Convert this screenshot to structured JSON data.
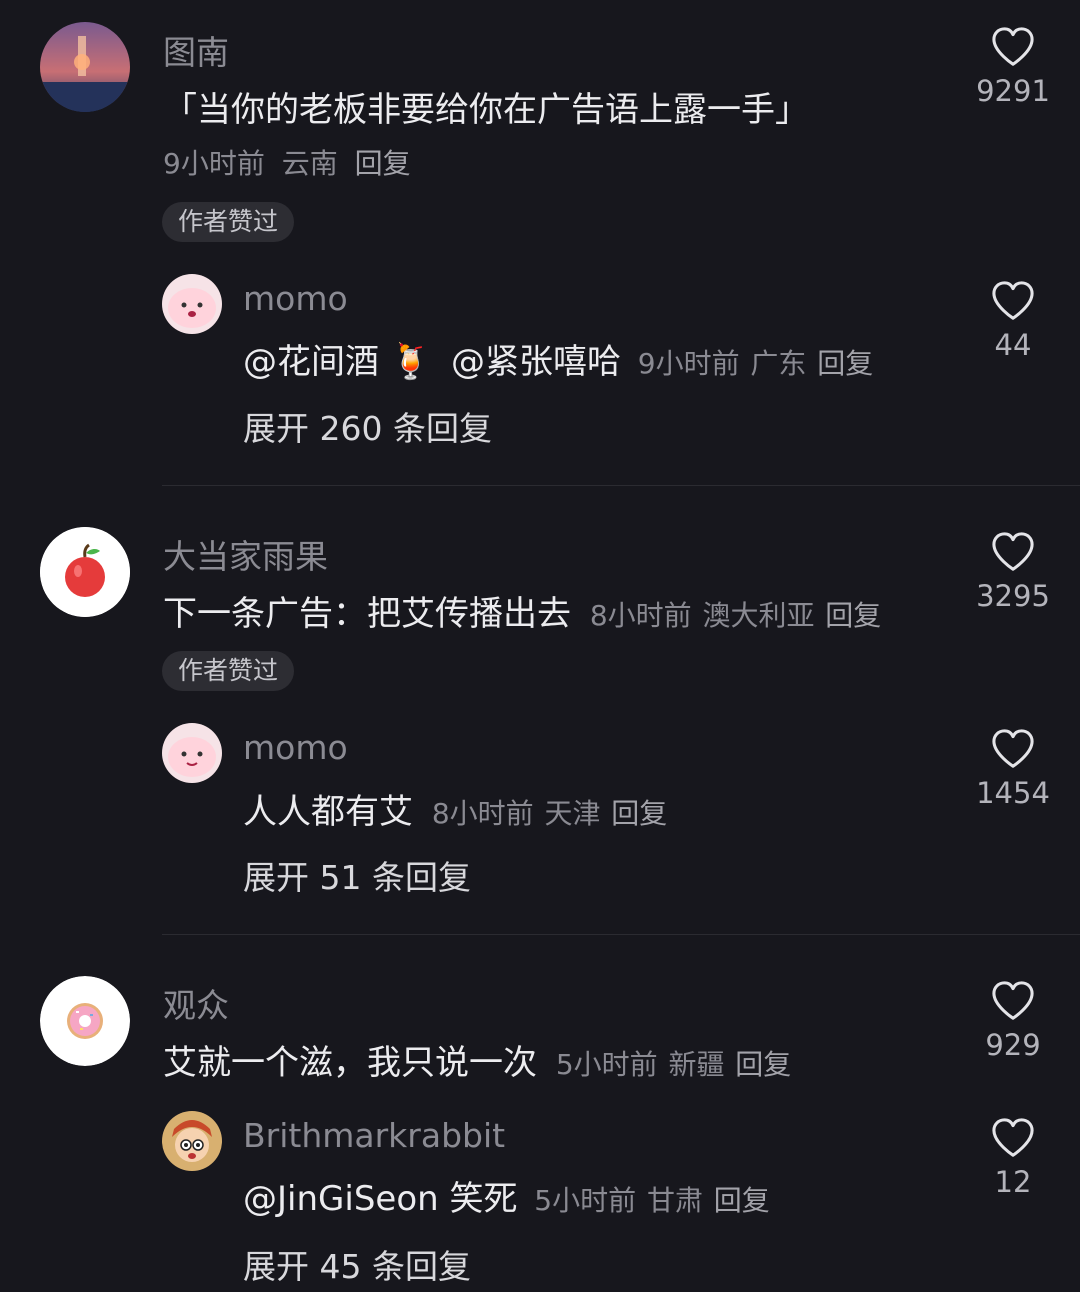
{
  "comments": [
    {
      "username": "图南",
      "text": "「当你的老板非要给你在广告语上露一手」",
      "time": "9小时前",
      "location": "云南",
      "reply_label": "回复",
      "likes": "9291",
      "badge": "作者赞过",
      "sub_reply": {
        "username": "momo",
        "mentions": [
          "@花间酒",
          "🍹",
          "@紧张嘻哈"
        ],
        "time": "9小时前",
        "location": "广东",
        "reply_label": "回复",
        "likes": "44"
      },
      "expand_label": "展开 260 条回复"
    },
    {
      "username": "大当家雨果",
      "text": "下一条广告：把艾传播出去",
      "time": "8小时前",
      "location": "澳大利亚",
      "reply_label": "回复",
      "likes": "3295",
      "badge": "作者赞过",
      "sub_reply": {
        "username": "momo",
        "text": "人人都有艾",
        "time": "8小时前",
        "location": "天津",
        "reply_label": "回复",
        "likes": "1454"
      },
      "expand_label": "展开 51 条回复"
    },
    {
      "username": "观众",
      "text": "艾就一个滋，我只说一次",
      "time": "5小时前",
      "location": "新疆",
      "reply_label": "回复",
      "likes": "929",
      "sub_reply": {
        "username": "Brithmarkrabbit",
        "mention": "@JinGiSeon",
        "text": "笑死",
        "time": "5小时前",
        "location": "甘肃",
        "reply_label": "回复",
        "likes": "12"
      },
      "expand_label": "展开 45 条回复"
    }
  ],
  "icons": {
    "like": "heart-outline-icon"
  },
  "colors": {
    "background": "#17171d",
    "primary_text": "#ececef",
    "secondary_text": "#8a8a92"
  }
}
